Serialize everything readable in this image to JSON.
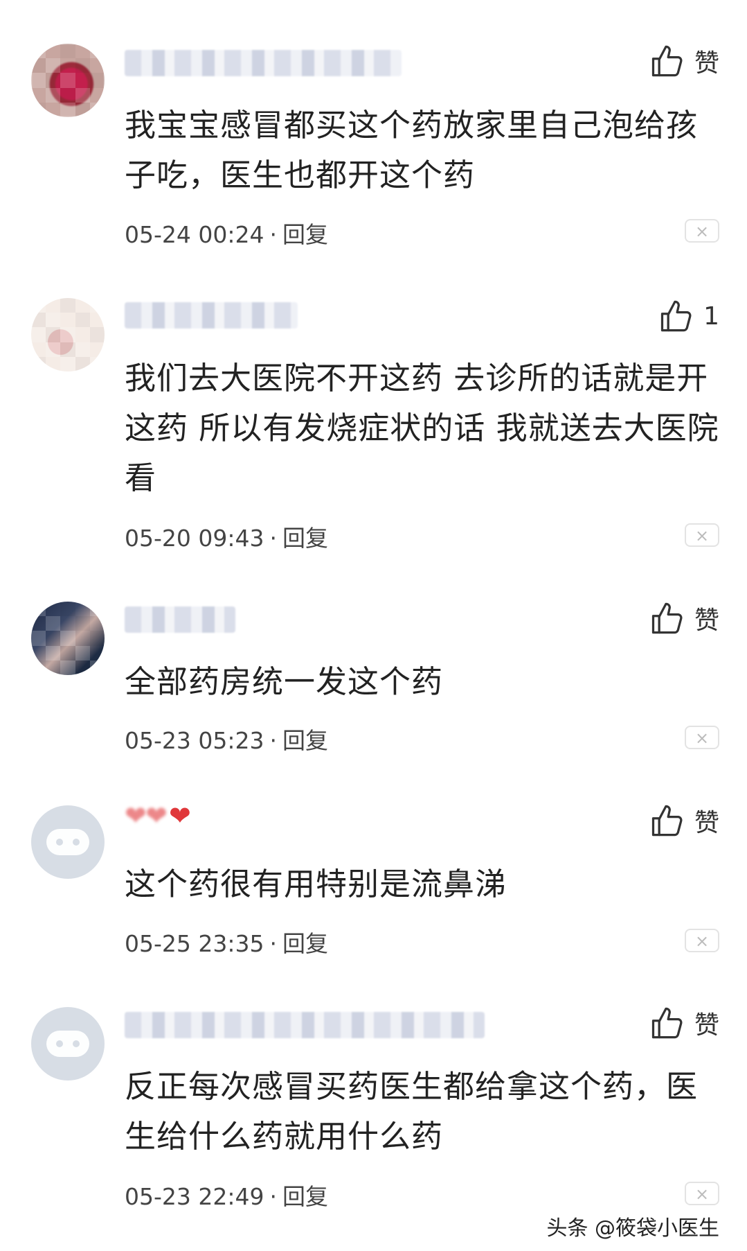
{
  "comments": [
    {
      "like_label": "赞",
      "text": "我宝宝感冒都买这个药放家里自己泡给孩子吃，医生也都开这个药",
      "date": "05-24 00:24",
      "reply": "回复"
    },
    {
      "like_label": "1",
      "text": "我们去大医院不开这药 去诊所的话就是开这药 所以有发烧症状的话 我就送去大医院看",
      "date": "05-20 09:43",
      "reply": "回复"
    },
    {
      "like_label": "赞",
      "text": "全部药房统一发这个药",
      "date": "05-23 05:23",
      "reply": "回复"
    },
    {
      "like_label": "赞",
      "text": "这个药很有用特别是流鼻涕",
      "date": "05-25 23:35",
      "reply": "回复"
    },
    {
      "like_label": "赞",
      "text": "反正每次感冒买药医生都给拿这个药，医生给什么药就用什么药",
      "date": "05-23 22:49",
      "reply": "回复"
    }
  ],
  "separator": "·",
  "close_glyph": "×",
  "heart_glyph": "❤",
  "watermark": "头条 @筱袋小医生",
  "colors": {
    "heart": "#e0383b",
    "text": "#222222",
    "meta": "#444444"
  },
  "icons": {
    "like": "thumbs-up-icon",
    "close": "close-icon"
  }
}
